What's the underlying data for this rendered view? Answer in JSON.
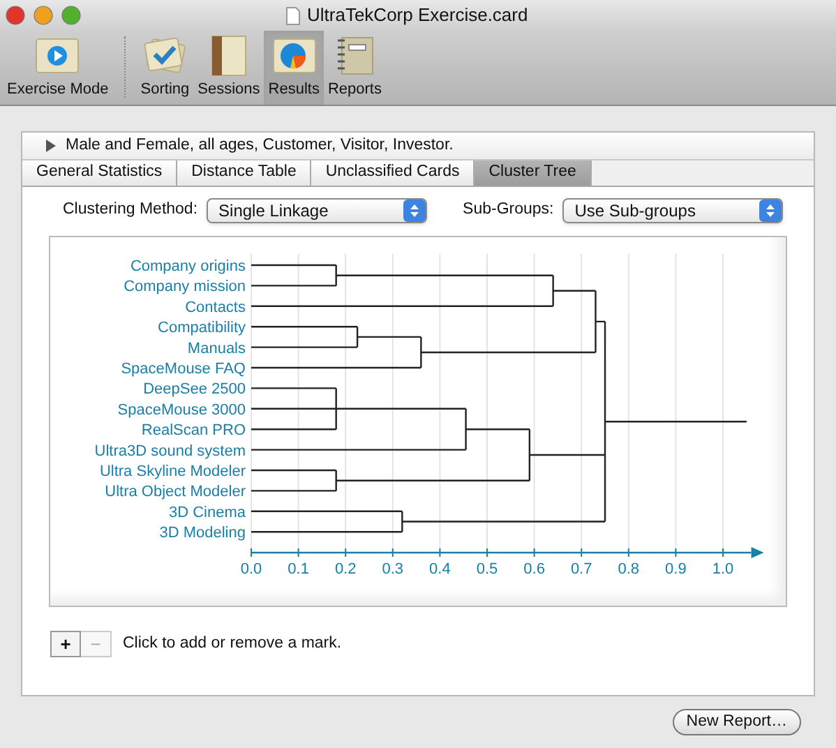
{
  "window": {
    "title": "UltraTekCorp Exercise.card"
  },
  "toolbar": [
    {
      "label": "Exercise Mode",
      "kind": "exercise",
      "selected": false
    },
    {
      "label": "Sorting",
      "kind": "sorting",
      "selected": false
    },
    {
      "label": "Sessions",
      "kind": "sessions",
      "selected": false
    },
    {
      "label": "Results",
      "kind": "results",
      "selected": true
    },
    {
      "label": "Reports",
      "kind": "reports",
      "selected": false
    }
  ],
  "filter": {
    "text": "Male and Female, all ages, Customer, Visitor, Investor.",
    "expanded": false
  },
  "tabs": [
    {
      "label": "General Statistics",
      "selected": false
    },
    {
      "label": "Distance Table",
      "selected": false
    },
    {
      "label": "Unclassified Cards",
      "selected": false
    },
    {
      "label": "Cluster Tree",
      "selected": true
    }
  ],
  "controls": [
    {
      "label": "Clustering Method:",
      "value": "Single Linkage"
    },
    {
      "label": "Sub-Groups:",
      "value": "Use Sub-groups"
    }
  ],
  "dendrogram": {
    "leaves": [
      "Company origins",
      "Company mission",
      "Contacts",
      "Compatibility",
      "Manuals",
      "SpaceMouse FAQ",
      "DeepSee 2500",
      "SpaceMouse 3000",
      "RealScan PRO",
      "Ultra3D sound system",
      "Ultra Skyline Modeler",
      "Ultra Object Modeler",
      "3D Cinema",
      "3D Modeling"
    ],
    "axis_ticks": [
      "0.0",
      "0.1",
      "0.2",
      "0.3",
      "0.4",
      "0.5",
      "0.6",
      "0.7",
      "0.8",
      "0.9",
      "1.0"
    ]
  },
  "marks": {
    "add": "+",
    "remove": "−",
    "hint": "Click to add or remove a mark."
  },
  "new_report_button": "New Report…"
}
